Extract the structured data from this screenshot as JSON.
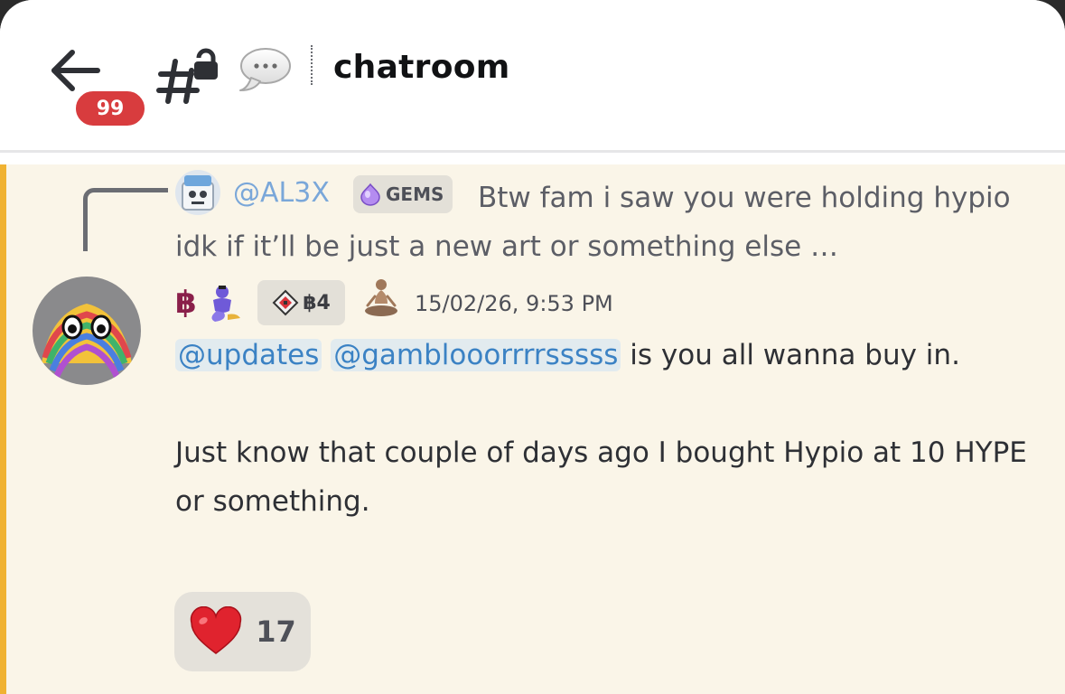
{
  "header": {
    "unread_count": "99",
    "channel_name": "chatroom",
    "icons": {
      "back": "arrow-left-icon",
      "channel": "locked-hashtag-icon",
      "thread": "speech-bubble-icon"
    }
  },
  "reply": {
    "author": "@AL3X",
    "tag_label": "GEMS",
    "text": "Btw fam i saw you were holding hypio idk if it’ll be just a new art or something else …"
  },
  "message": {
    "author_prefix": "฿",
    "role_tag_label": "฿4",
    "timestamp": "15/02/26, 9:53 PM",
    "mentions": [
      "@updates",
      "@gamblooorrrrsssss"
    ],
    "text_after_mentions": " is you all wanna buy in.",
    "paragraph_2": "Just know that couple of days ago I bought Hypio at 10 HYPE or something."
  },
  "reaction": {
    "emoji": "heart-emoji",
    "count": "17"
  },
  "colors": {
    "mention_highlight_bar": "#f0b232",
    "message_background": "#faf5e8",
    "badge_red": "#d83c3e",
    "mention_text": "#3b82c4",
    "reply_author": "#7aa7d9"
  }
}
